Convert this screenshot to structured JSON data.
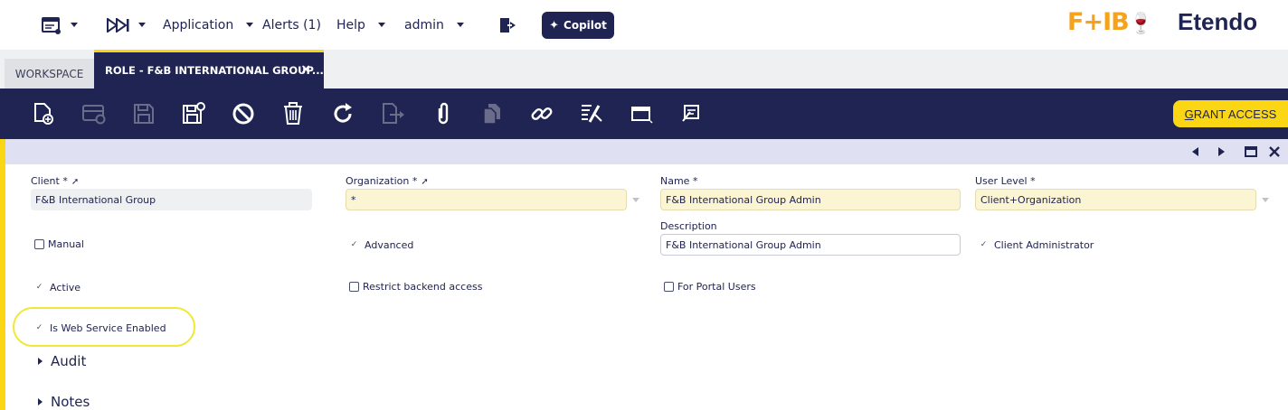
{
  "topnav": {
    "application": "Application",
    "alerts": "Alerts (1)",
    "help": "Help",
    "user": "admin",
    "copilot": "Copilot",
    "brand_fb": "F+IB",
    "brand_etendo": "Etendo"
  },
  "tabs": {
    "workspace": "WORKSPACE",
    "role": "ROLE - F&B INTERNATIONAL GROUP...",
    "close": "×"
  },
  "toolbar": {
    "grant_access_key": "G",
    "grant_access_rest": "RANT ACCESS"
  },
  "form": {
    "client_label": "Client *",
    "client_value": "F&B International Group",
    "organization_label": "Organization *",
    "organization_value": "*",
    "name_label": "Name *",
    "name_value": "F&B International Group Admin",
    "user_level_label": "User Level *",
    "user_level_value": "Client+Organization",
    "description_label": "Description",
    "description_value": "F&B International Group Admin",
    "manual": "Manual",
    "advanced": "Advanced",
    "client_admin": "Client Administrator",
    "active": "Active",
    "restrict_backend": "Restrict backend access",
    "portal_users": "For Portal Users",
    "web_service": "Is Web Service Enabled",
    "audit": "Audit",
    "notes": "Notes",
    "tick": "✓"
  },
  "colors": {
    "navy": "#202452",
    "accent_yellow": "#fad614",
    "field_yellow": "#fbf5d3"
  }
}
